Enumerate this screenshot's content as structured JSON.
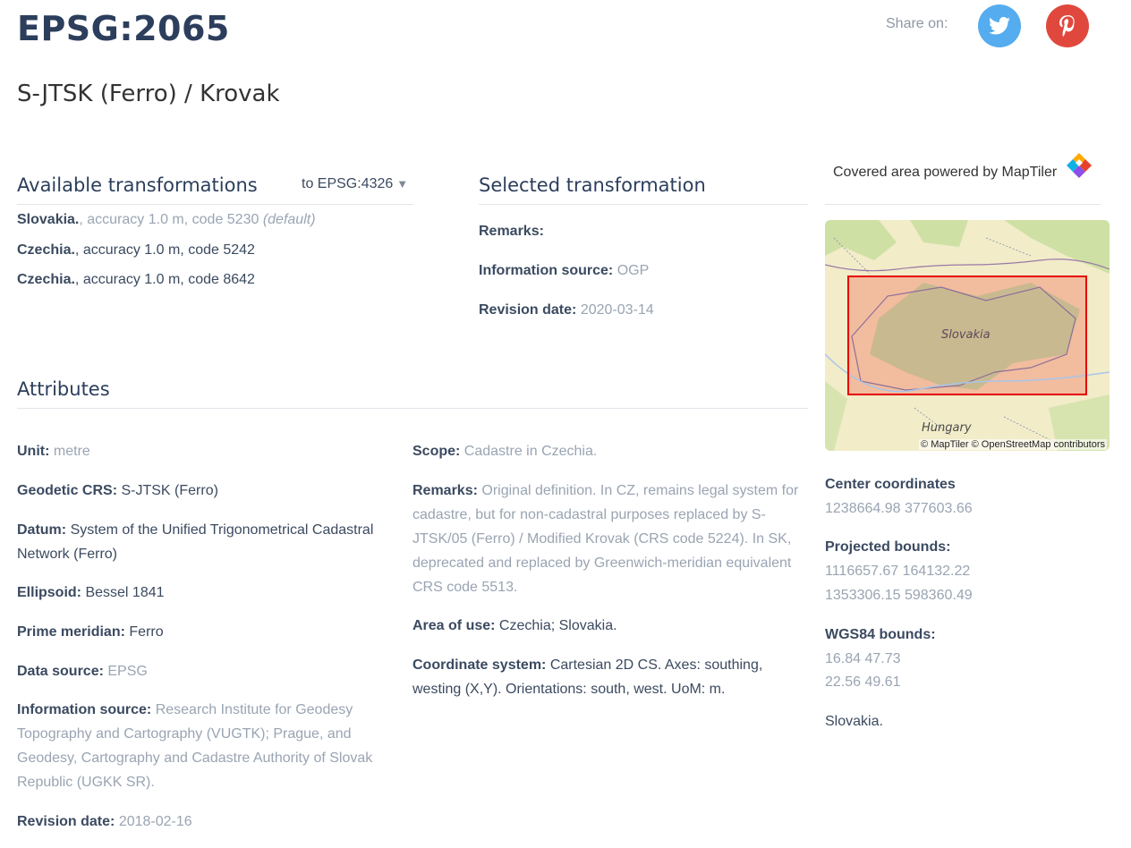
{
  "header": {
    "code": "EPSG:2065",
    "name": "S-JTSK (Ferro) / Krovak",
    "share_label": "Share on:"
  },
  "transformations": {
    "heading": "Available transformations",
    "target": "to EPSG:4326",
    "items": [
      {
        "region": "Slovakia.",
        "detail": ", accuracy 1.0 m, code 5230",
        "note": "(default)"
      },
      {
        "region": "Czechia.",
        "detail": ", accuracy 1.0 m, code 5242"
      },
      {
        "region": "Czechia.",
        "detail": ", accuracy 1.0 m, code 8642"
      }
    ]
  },
  "selected": {
    "heading": "Selected transformation",
    "remarks_label": "Remarks:",
    "remarks_value": "",
    "info_label": "Information source:",
    "info_value": "OGP",
    "rev_label": "Revision date:",
    "rev_value": "2020-03-14"
  },
  "map": {
    "heading": "Covered area powered by MapTiler",
    "label_country": "Slovakia",
    "label_neighbor": "Hungary",
    "attribution": "© MapTiler © OpenStreetMap contributors",
    "center_label": "Center coordinates",
    "center_value": "1238664.98 377603.66",
    "proj_label": "Projected bounds:",
    "proj_line1": "1116657.67 164132.22",
    "proj_line2": "1353306.15 598360.49",
    "wgs_label": "WGS84 bounds:",
    "wgs_line1": "16.84 47.73",
    "wgs_line2": "22.56 49.61",
    "area_name": "Slovakia."
  },
  "attributes": {
    "heading": "Attributes",
    "unit_label": "Unit:",
    "unit_value": "metre",
    "gcrs_label": "Geodetic CRS:",
    "gcrs_value": "S-JTSK (Ferro)",
    "datum_label": "Datum:",
    "datum_value": "System of the Unified Trigonometrical Cadastral Network (Ferro)",
    "ellipsoid_label": "Ellipsoid:",
    "ellipsoid_value": "Bessel 1841",
    "pm_label": "Prime meridian:",
    "pm_value": "Ferro",
    "ds_label": "Data source:",
    "ds_value": "EPSG",
    "is_label": "Information source:",
    "is_value": "Research Institute for Geodesy Topography and Cartography (VUGTK); Prague, and Geodesy, Cartography and Cadastre Authority of Slovak Republic (UGKK SR).",
    "rd_label": "Revision date:",
    "rd_value": "2018-02-16",
    "scope_label": "Scope:",
    "scope_value": "Cadastre in Czechia.",
    "remarks_label": "Remarks:",
    "remarks_value": "Original definition. In CZ, remains legal system for cadastre, but for non-cadastral purposes replaced by S-JTSK/05 (Ferro) / Modified Krovak (CRS code 5224). In SK, deprecated and replaced by Greenwich-meridian equivalent CRS code 5513.",
    "aou_label": "Area of use:",
    "aou_value": "Czechia; Slovakia.",
    "cs_label": "Coordinate system:",
    "cs_value": "Cartesian 2D CS. Axes: southing, westing (X,Y). Orientations: south, west. UoM: m."
  }
}
